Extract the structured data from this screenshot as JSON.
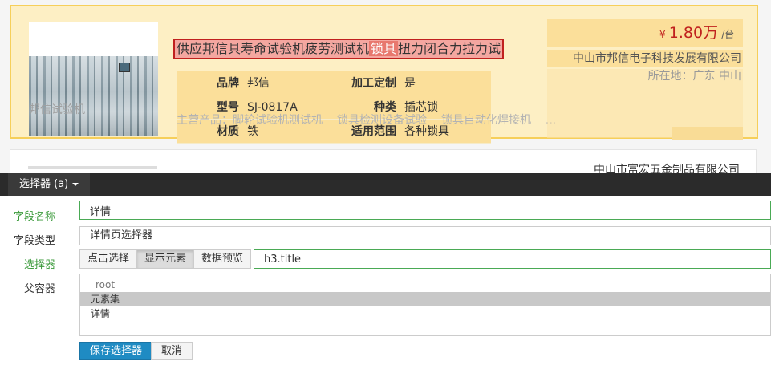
{
  "preview": {
    "item1": {
      "title_before": "供应邦信具寿命试验机疲劳测试机",
      "title_highlight": "锁具",
      "title_after": "扭力闭合力拉力试",
      "attributes": [
        {
          "label1": "品牌",
          "value1": "邦信",
          "label2": "加工定制",
          "value2": "是"
        },
        {
          "label1": "型号",
          "value1": "SJ-0817A",
          "label2": "种类",
          "value2": "插芯锁"
        },
        {
          "label1": "材质",
          "value1": "铁",
          "label2": "适用范围",
          "value2": "各种锁具"
        }
      ],
      "main_products_label": "主营产品：",
      "main_products": [
        "脚轮试验机测试机",
        "锁具检测设备试验",
        "锁具自动化焊接机",
        "..."
      ],
      "watermark": "邦信试验机",
      "price_currency": "¥",
      "price_value": "1.80万",
      "price_unit": "/台",
      "company": "中山市邦信电子科技发展有限公司",
      "location": "所在地：广东 中山"
    },
    "item2": {
      "company": "中山市富宏五金制品有限公司"
    }
  },
  "toolbar": {
    "selector_menu": "选择器 (a)"
  },
  "form": {
    "field_name_label": "字段名称",
    "field_name_value": "详情",
    "field_type_label": "字段类型",
    "field_type_value": "详情页选择器",
    "selector_label": "选择器",
    "btn_click_select": "点击选择",
    "btn_show_elements": "显示元素",
    "btn_data_preview": "数据预览",
    "selector_value": "h3.title",
    "parent_label": "父容器",
    "parent_options": [
      "_root",
      "元素集",
      "详情"
    ],
    "parent_selected_index": 1,
    "save_button": "保存选择器",
    "cancel_button": "取消"
  },
  "colors": {
    "highlight_bg": "#fdefc4",
    "title_border": "#c0211e",
    "primary": "#1f8bc3",
    "green_label": "#3c9b3c",
    "toolbar_bg": "#2b2b2b"
  }
}
